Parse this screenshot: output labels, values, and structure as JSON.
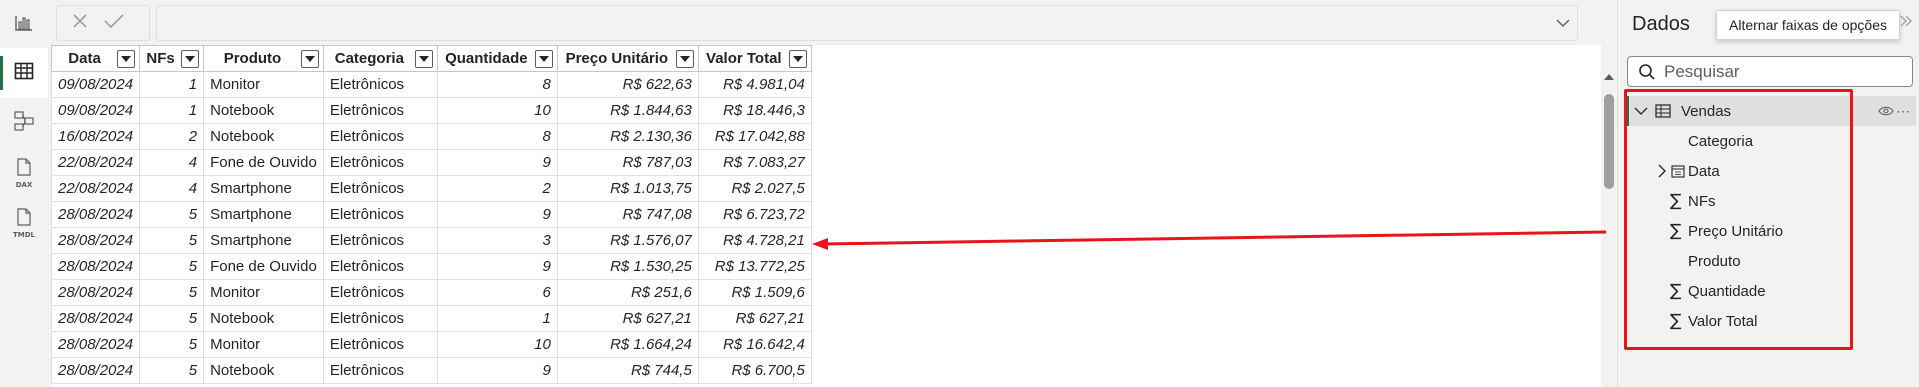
{
  "formula_bar": {
    "value": ""
  },
  "table": {
    "columns": [
      "Data",
      "NFs",
      "Produto",
      "Categoria",
      "Quantidade",
      "Preço Unitário",
      "Valor Total"
    ],
    "rows": [
      [
        "09/08/2024",
        "1",
        "Monitor",
        "Eletrônicos",
        "8",
        "R$ 622,63",
        "R$ 4.981,04"
      ],
      [
        "09/08/2024",
        "1",
        "Notebook",
        "Eletrônicos",
        "10",
        "R$ 1.844,63",
        "R$ 18.446,3"
      ],
      [
        "16/08/2024",
        "2",
        "Notebook",
        "Eletrônicos",
        "8",
        "R$ 2.130,36",
        "R$ 17.042,88"
      ],
      [
        "22/08/2024",
        "4",
        "Fone de Ouvido",
        "Eletrônicos",
        "9",
        "R$ 787,03",
        "R$ 7.083,27"
      ],
      [
        "22/08/2024",
        "4",
        "Smartphone",
        "Eletrônicos",
        "2",
        "R$ 1.013,75",
        "R$ 2.027,5"
      ],
      [
        "28/08/2024",
        "5",
        "Smartphone",
        "Eletrônicos",
        "9",
        "R$ 747,08",
        "R$ 6.723,72"
      ],
      [
        "28/08/2024",
        "5",
        "Smartphone",
        "Eletrônicos",
        "3",
        "R$ 1.576,07",
        "R$ 4.728,21"
      ],
      [
        "28/08/2024",
        "5",
        "Fone de Ouvido",
        "Eletrônicos",
        "9",
        "R$ 1.530,25",
        "R$ 13.772,25"
      ],
      [
        "28/08/2024",
        "5",
        "Monitor",
        "Eletrônicos",
        "6",
        "R$ 251,6",
        "R$ 1.509,6"
      ],
      [
        "28/08/2024",
        "5",
        "Notebook",
        "Eletrônicos",
        "1",
        "R$ 627,21",
        "R$ 627,21"
      ],
      [
        "28/08/2024",
        "5",
        "Monitor",
        "Eletrônicos",
        "10",
        "R$ 1.664,24",
        "R$ 16.642,4"
      ],
      [
        "28/08/2024",
        "5",
        "Notebook",
        "Eletrônicos",
        "9",
        "R$ 744,5",
        "R$ 6.700,5"
      ]
    ]
  },
  "data_pane": {
    "title": "Dados",
    "tooltip": "Alternar faixas de opções",
    "search_placeholder": "Pesquisar",
    "table_name": "Vendas",
    "fields": [
      {
        "label": "Categoria",
        "icon": "none"
      },
      {
        "label": "Data",
        "icon": "calendar-icon",
        "expandable": true
      },
      {
        "label": "NFs",
        "icon": "sigma-icon"
      },
      {
        "label": "Preço Unitário",
        "icon": "sigma-icon"
      },
      {
        "label": "Produto",
        "icon": "none"
      },
      {
        "label": "Quantidade",
        "icon": "sigma-icon"
      },
      {
        "label": "Valor Total",
        "icon": "sigma-icon"
      }
    ]
  },
  "left_rail": {
    "items": [
      {
        "name": "report-view",
        "icon": "bar-chart-icon"
      },
      {
        "name": "table-view",
        "icon": "table-grid-icon",
        "active": true
      },
      {
        "name": "model-view",
        "icon": "model-icon"
      },
      {
        "name": "dax-query-view",
        "icon": "dax-icon",
        "label": "DAX"
      },
      {
        "name": "tmdl-view",
        "icon": "tmdl-icon",
        "label": "TMDL"
      }
    ]
  },
  "colors": {
    "highlight": "#e8141c",
    "accent": "#217346"
  }
}
